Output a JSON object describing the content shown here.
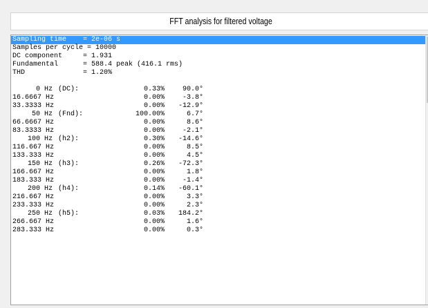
{
  "title": "FFT analysis for filtered voltage",
  "header_lines": [
    "Sampling time    = 2e-06 s",
    "Samples per cycle = 10000",
    "DC component     = 1.931",
    "Fundamental      = 588.4 peak (416.1 rms)",
    "THD              = 1.20%"
  ],
  "rows": [
    {
      "freq": "0 Hz",
      "harm": "(DC):",
      "pct": "0.33%",
      "phase": "90.0°",
      "ralign": true
    },
    {
      "freq": "16.6667 Hz",
      "harm": "",
      "pct": "0.00%",
      "phase": "-3.8°",
      "ralign": false
    },
    {
      "freq": "33.3333 Hz",
      "harm": "",
      "pct": "0.00%",
      "phase": "-12.9°",
      "ralign": false
    },
    {
      "freq": "50 Hz",
      "harm": "(Fnd):",
      "pct": "100.00%",
      "phase": "6.7°",
      "ralign": true
    },
    {
      "freq": "66.6667 Hz",
      "harm": "",
      "pct": "0.00%",
      "phase": "8.6°",
      "ralign": false
    },
    {
      "freq": "83.3333 Hz",
      "harm": "",
      "pct": "0.00%",
      "phase": "-2.1°",
      "ralign": false
    },
    {
      "freq": "100 Hz",
      "harm": "(h2):",
      "pct": "0.30%",
      "phase": "-14.6°",
      "ralign": true
    },
    {
      "freq": "116.667 Hz",
      "harm": "",
      "pct": "0.00%",
      "phase": "8.5°",
      "ralign": false
    },
    {
      "freq": "133.333 Hz",
      "harm": "",
      "pct": "0.00%",
      "phase": "4.5°",
      "ralign": false
    },
    {
      "freq": "150 Hz",
      "harm": "(h3):",
      "pct": "0.26%",
      "phase": "-72.3°",
      "ralign": true
    },
    {
      "freq": "166.667 Hz",
      "harm": "",
      "pct": "0.00%",
      "phase": "1.8°",
      "ralign": false
    },
    {
      "freq": "183.333 Hz",
      "harm": "",
      "pct": "0.00%",
      "phase": "-1.4°",
      "ralign": false
    },
    {
      "freq": "200 Hz",
      "harm": "(h4):",
      "pct": "0.14%",
      "phase": "-60.1°",
      "ralign": true
    },
    {
      "freq": "216.667 Hz",
      "harm": "",
      "pct": "0.00%",
      "phase": "3.3°",
      "ralign": false
    },
    {
      "freq": "233.333 Hz",
      "harm": "",
      "pct": "0.00%",
      "phase": "2.3°",
      "ralign": false
    },
    {
      "freq": "250 Hz",
      "harm": "(h5):",
      "pct": "0.03%",
      "phase": "184.2°",
      "ralign": true
    },
    {
      "freq": "266.667 Hz",
      "harm": "",
      "pct": "0.00%",
      "phase": "1.6°",
      "ralign": false
    },
    {
      "freq": "283.333 Hz",
      "harm": "",
      "pct": "0.00%",
      "phase": "0.3°",
      "ralign": false
    }
  ],
  "colors": {
    "selection": "#3399ff",
    "background": "#ffffff",
    "window": "#f0f0f0"
  }
}
